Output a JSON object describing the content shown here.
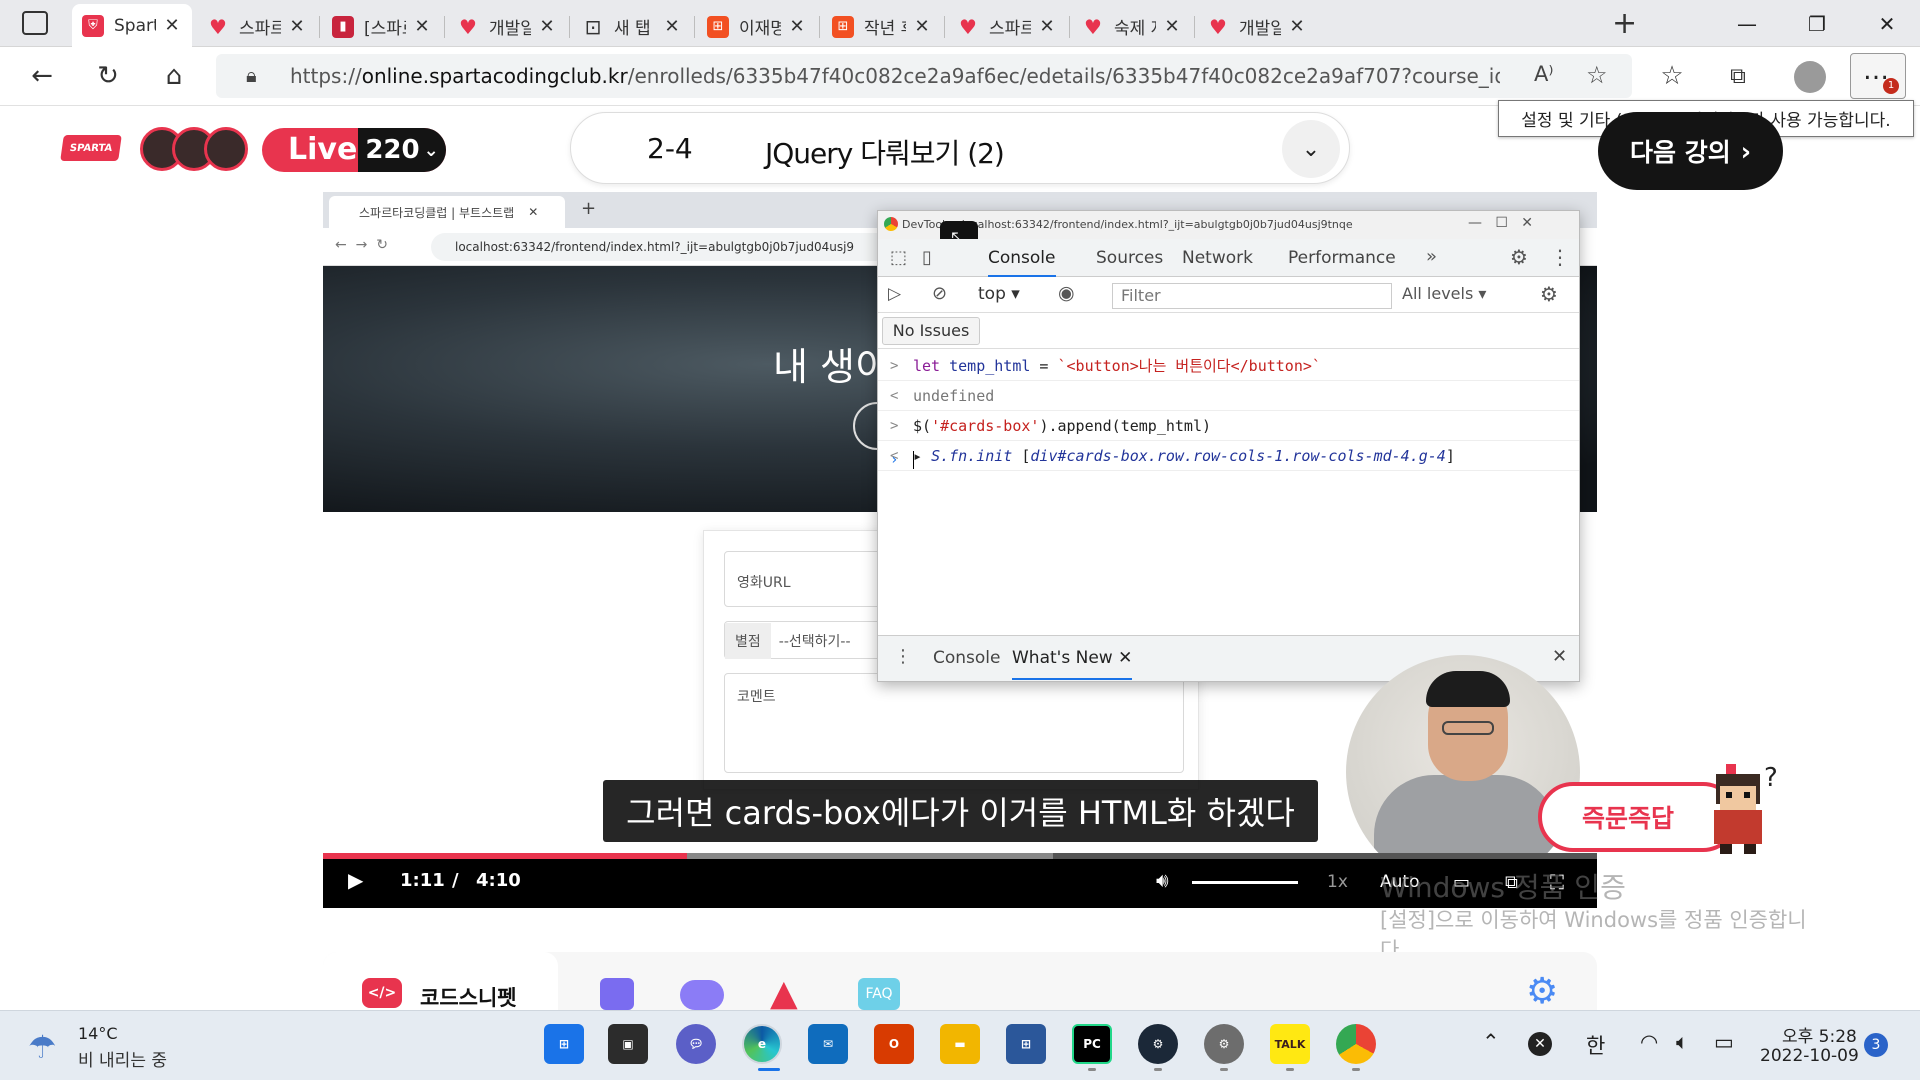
{
  "browser": {
    "tabs": [
      {
        "title": "Sparta",
        "active": true,
        "icon": "sparta-icon"
      },
      {
        "title": "스파르",
        "icon": "sparta-heart-icon"
      },
      {
        "title": "[스파르",
        "icon": "book-icon"
      },
      {
        "title": "개발일",
        "icon": "sparta-heart-icon"
      },
      {
        "title": "새 탭",
        "icon": "new-tab-icon"
      },
      {
        "title": "이재명",
        "icon": "microsoft-icon"
      },
      {
        "title": "작년 후",
        "icon": "microsoft-icon"
      },
      {
        "title": "스파르",
        "icon": "sparta-heart-icon"
      },
      {
        "title": "숙제 저",
        "icon": "sparta-heart-icon"
      },
      {
        "title": "개발일",
        "icon": "sparta-heart-icon"
      }
    ],
    "url_prefix": "https://",
    "url_domain": "online.spartacodingclub.kr",
    "url_path": "/enrolleds/6335b47f40c082ce2a9af6ec/edetails/6335b47f40c082ce2a9af707?course_id=60a5ee4...",
    "settings_badge": "1",
    "tooltip": "설정 및 기타 (Alt+F). 업데이트가 사용 가능합니다."
  },
  "header": {
    "logo": "SPARTA",
    "live_label": "Live",
    "live_count": "220",
    "lesson_number": "2-4",
    "lesson_title": "JQuery 다뤄보기 (2)",
    "next_button": "다음 강의"
  },
  "video_screen": {
    "inner_tab": "스파르타코딩클럽 | 부트스트랩",
    "inner_url": "localhost:63342/frontend/index.html?_ijt=abulgtgb0j0b7jud04usj9",
    "hero_text": "내 생이",
    "form": {
      "url_placeholder": "영화URL",
      "star_label": "별점",
      "star_select": "--선택하기--",
      "comment_placeholder": "코멘트"
    },
    "devtools": {
      "title": "DevTools - localhost:63342/frontend/index.html?_ijt=abulgtgb0j0b7jud04usj9tnqe",
      "tabs": [
        "Console",
        "Sources",
        "Network",
        "Performance"
      ],
      "context": "top",
      "filter_placeholder": "Filter",
      "levels": "All levels",
      "issues": "No Issues",
      "console": [
        {
          "arrow": ">",
          "parts": [
            [
              "kw",
              "let "
            ],
            [
              "vr",
              "temp_html"
            ],
            [
              "",
              "  = "
            ],
            [
              "st",
              "`<button>나는 버튼이다</button>`"
            ]
          ]
        },
        {
          "arrow": "<",
          "parts": [
            [
              "gray",
              "undefined"
            ]
          ]
        },
        {
          "arrow": ">",
          "parts": [
            [
              "",
              "$("
            ],
            [
              "st",
              "'#cards-box'"
            ],
            [
              "",
              ").append(temp_html)"
            ]
          ]
        },
        {
          "arrow": "<",
          "parts": [
            [
              "",
              "▸ "
            ],
            [
              "it",
              "S.fn.init "
            ],
            [
              "",
              "["
            ],
            [
              "it",
              "div#cards-box.row.row-cols-1.row-cols-md-4.g-4"
            ],
            [
              "",
              "]"
            ]
          ]
        }
      ],
      "drawer_tabs": [
        "Console",
        "What's New"
      ]
    }
  },
  "subtitle": "그러면 cards-box에다가 이거를 HTML화 하겠다",
  "player": {
    "progress": 0.286,
    "buffered": 0.573,
    "current_time": "1:11",
    "separator": "/",
    "total_time": "4:10",
    "speed": "1x",
    "quality": "Auto"
  },
  "qa_button": "즉문즉답",
  "activation": {
    "line1": "Windows 정품 인증",
    "line2": "[설정]으로 이동하여 Windows를 정품 인증합니",
    "line3": "다."
  },
  "bottom": {
    "snippet_label": "코드스니펫",
    "faq": "FAQ"
  },
  "taskbar": {
    "weather_temp": "14°C",
    "weather_desc": "비 내리는 중",
    "ime": "한",
    "time": "오후 5:28",
    "date": "2022-10-09",
    "notifications": "3"
  },
  "colors": {
    "brand": "#e8344e",
    "accent": "#1a73e8"
  }
}
